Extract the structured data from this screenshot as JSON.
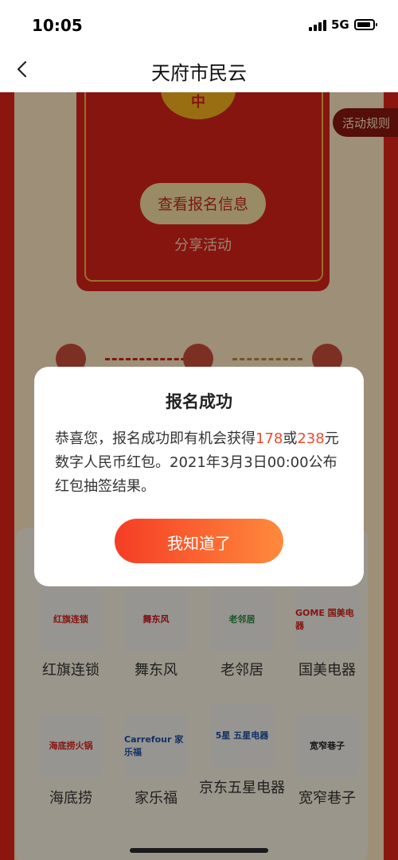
{
  "status_bar": {
    "time": "10:05",
    "network": "5G"
  },
  "nav": {
    "title": "天府市民云"
  },
  "envelope": {
    "coin_char": "中",
    "view_button": "查看报名信息",
    "share": "分享活动"
  },
  "rules_label": "活动规则",
  "modal": {
    "title": "报名成功",
    "body_prefix": "恭喜您，报名成功即有机会获得",
    "amount1": "178",
    "or": "或",
    "amount2": "238",
    "body_suffix": "元数字人民币红包。2021年3月3日00:00公布红包抽签结果。",
    "button": "我知道了"
  },
  "stores": [
    {
      "name": "红旗连锁",
      "logo_text": "红旗连锁",
      "color": "#d8231a"
    },
    {
      "name": "舞东风",
      "logo_text": "舞东风",
      "color": "#c8161d"
    },
    {
      "name": "老邻居",
      "logo_text": "老邻居",
      "color": "#2e8b3a"
    },
    {
      "name": "国美电器",
      "logo_text": "GOME 国美电器",
      "color": "#d8231a"
    },
    {
      "name": "海底捞",
      "logo_text": "海底捞火锅",
      "color": "#d8231a"
    },
    {
      "name": "家乐福",
      "logo_text": "Carrefour 家乐福",
      "color": "#1e4fa2"
    },
    {
      "name": "京东五星电器",
      "logo_text": "5星 五星电器",
      "color": "#1e4fa2"
    },
    {
      "name": "宽窄巷子",
      "logo_text": "宽窄巷子",
      "color": "#222222"
    }
  ]
}
